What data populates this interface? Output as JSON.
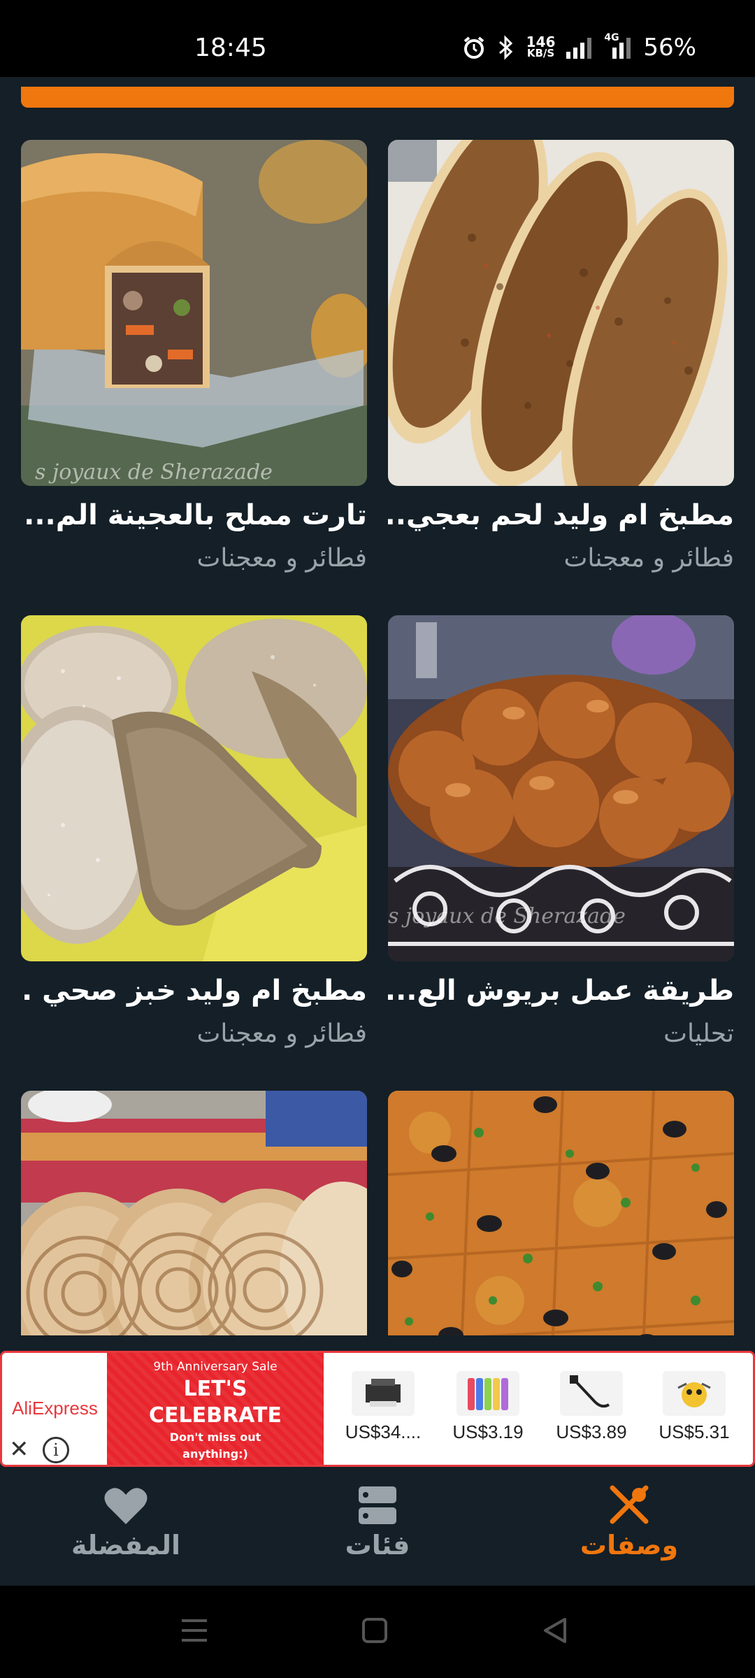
{
  "status_bar": {
    "time": "18:45",
    "net_speed_value": "146",
    "net_speed_unit": "KB/S",
    "network_type": "4G",
    "battery": "56%",
    "icons": [
      "alarm-icon",
      "bluetooth-icon",
      "signal-icon",
      "signal-4g-icon"
    ]
  },
  "accent_color": "#f0760e",
  "recipes": [
    {
      "title": "مطبخ ام وليد لحم بعجي...",
      "category": "فطائر و معجنات",
      "image": "lahm-bi-ajeen-photo"
    },
    {
      "title": "تارت مملح بالعجينة الم...",
      "category": "فطائر و معجنات",
      "image": "savory-tart-photo"
    },
    {
      "title": "طريقة عمل بريوش الع...",
      "category": "تحليات",
      "image": "brioche-photo"
    },
    {
      "title": "مطبخ ام وليد خبز صحي ...",
      "category": "فطائر و معجنات",
      "image": "healthy-bread-photo"
    },
    {
      "title": "",
      "category": "",
      "image": "pizza-olives-photo"
    },
    {
      "title": "",
      "category": "",
      "image": "flatbread-photo"
    }
  ],
  "watermarks": {
    "tart": "s joyaux de Sherazade",
    "brioche": "s joyaux de Sherazade"
  },
  "ad": {
    "brand": "AliExpress",
    "promo_sale": "9th Anniversary Sale",
    "promo_headline_1": "LET'S",
    "promo_headline_2": "CELEBRATE",
    "promo_sub_1": "Don't miss out",
    "promo_sub_2": "anything:)",
    "close_symbol": "✕",
    "info_symbol": "i",
    "products": [
      {
        "price": "US$34....",
        "icon": "printer-product-icon"
      },
      {
        "price": "US$3.19",
        "icon": "phone-case-product-icon"
      },
      {
        "price": "US$3.89",
        "icon": "cable-product-icon"
      },
      {
        "price": "US$5.31",
        "icon": "toy-product-icon"
      }
    ]
  },
  "bottom_nav": {
    "active_color": "#f0760e",
    "inactive_color": "#9aa3aa",
    "items": [
      {
        "label": "المفضلة",
        "icon": "heart-icon",
        "active": false
      },
      {
        "label": "فئات",
        "icon": "categories-icon",
        "active": false
      },
      {
        "label": "وصفات",
        "icon": "fork-knife-icon",
        "active": true
      }
    ]
  },
  "system_nav": {
    "buttons": [
      "menu-icon",
      "home-icon",
      "back-icon"
    ]
  }
}
